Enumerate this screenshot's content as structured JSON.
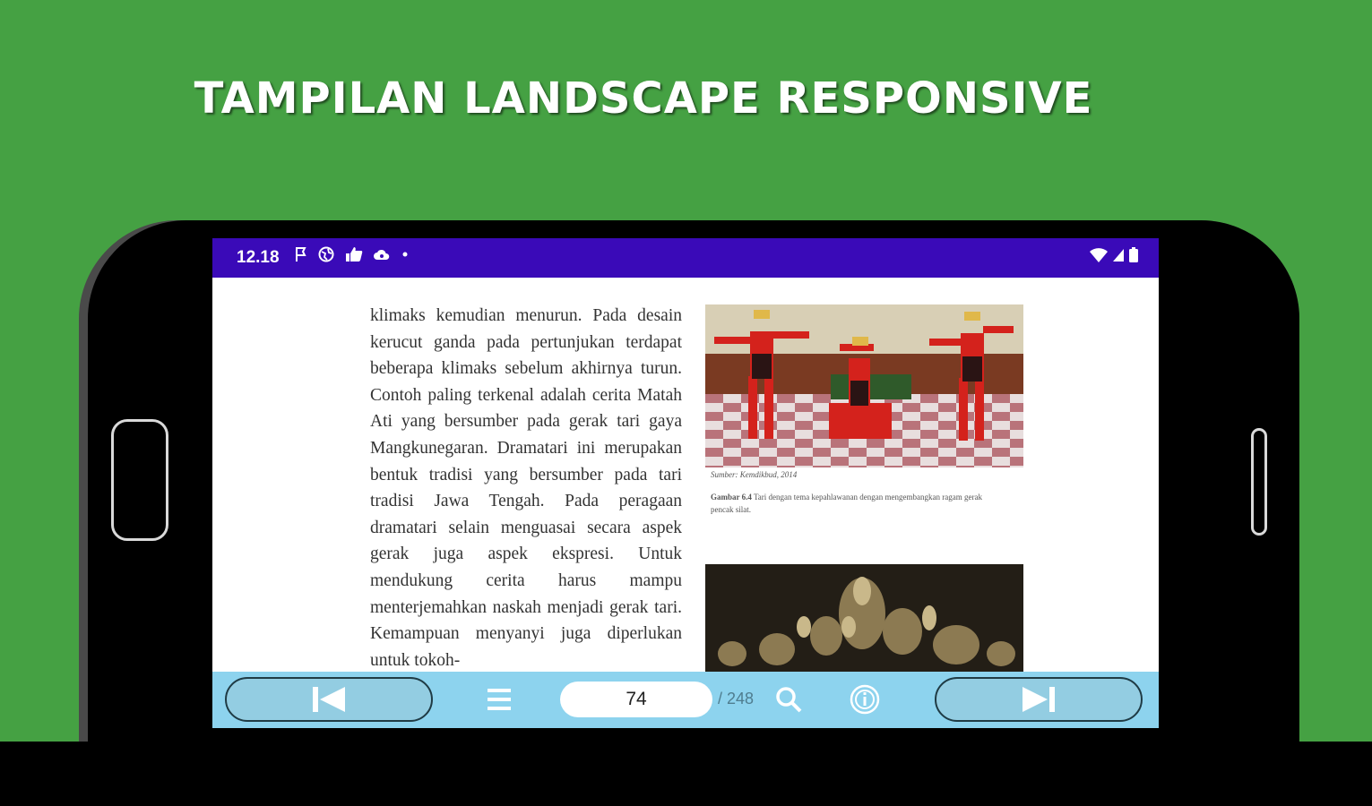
{
  "headline": "TAMPILAN LANDSCAPE RESPONSIVE",
  "colors": {
    "background": "#45a143",
    "status_bar": "#3a0ab8",
    "bottom_bar": "#8dd3ee"
  },
  "status_bar": {
    "time": "12.18",
    "left_icons": [
      "flag-icon",
      "globe-icon",
      "thumbs-up-icon",
      "cloud-icon",
      "dot-icon"
    ],
    "right_icons": [
      "wifi-icon",
      "signal-icon",
      "battery-icon"
    ]
  },
  "book": {
    "paragraph": "klimaks kemudian menurun. Pada desain kerucut ganda pada pertunjukan terdapat beberapa klimaks sebelum akhirnya turun. Contoh paling terkenal adalah cerita Matah Ati yang bersumber pada gerak tari gaya Mangkunegaran. Dramatari ini merupakan bentuk tradisi yang bersumber pada tari tradisi Jawa Tengah. Pada peragaan dramatari selain menguasai secara aspek gerak juga aspek ekspresi. Untuk mendukung cerita harus mampu menterjemahkan naskah menjadi gerak tari. Kemampuan menyanyi juga diperlukan untuk tokoh-",
    "figure_source": "Sumber: Kemdikbud, 2014",
    "figure_label": "Gambar 6.4",
    "figure_caption": "Tari dengan tema kepahlawanan dengan mengembangkan ragam gerak pencak silat."
  },
  "toolbar": {
    "prev_icon": "skip-previous-icon",
    "menu_icon": "menu-icon",
    "page_number": "74",
    "total_pages": "/ 248",
    "search_icon": "search-icon",
    "info_icon": "info-icon",
    "next_icon": "skip-next-icon"
  }
}
